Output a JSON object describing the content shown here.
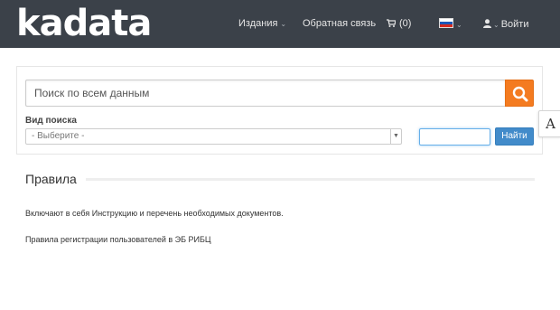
{
  "header": {
    "logo_text": "kadata",
    "nav": {
      "editions_label": "Издания",
      "feedback_label": "Обратная связь",
      "cart_label": "(0)",
      "login_label": "Войти"
    },
    "colors": {
      "bar": "#3b4149",
      "text": "#e6e6e6"
    }
  },
  "search": {
    "placeholder": "Поиск по всем данным",
    "type_label": "Вид поиска",
    "type_selected": "- Выберите -",
    "find_button_label": "Найти",
    "button_color": "#f47b20",
    "find_color": "#428bca"
  },
  "accessibility": {
    "font_toggle_label": "A"
  },
  "content": {
    "title": "Правила",
    "paragraphs": [
      "Включают в себя Инструкцию и перечень необходимых документов.",
      "Правила регистрации пользователей в ЭБ РИБЦ"
    ]
  }
}
